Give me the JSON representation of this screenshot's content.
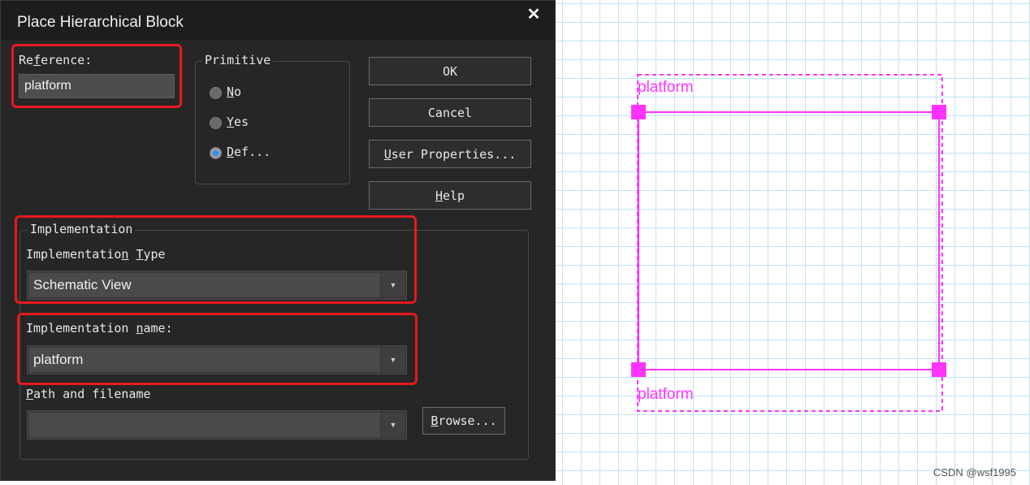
{
  "dialog": {
    "title": "Place Hierarchical Block",
    "close_glyph": "✕",
    "reference": {
      "label_pre": "Re",
      "label_u": "f",
      "label_post": "erence:",
      "value": "platform"
    },
    "primitive": {
      "legend": "Primitive",
      "options": [
        {
          "u": "N",
          "rest": "o",
          "selected": false
        },
        {
          "u": "Y",
          "rest": "es",
          "selected": false
        },
        {
          "u": "D",
          "rest": "ef...",
          "selected": true
        }
      ]
    },
    "buttons": {
      "ok": "OK",
      "cancel": "Cancel",
      "user_props_u": "U",
      "user_props_rest": "ser Properties...",
      "help_u": "H",
      "help_rest": "elp"
    },
    "implementation": {
      "legend": "Implementation",
      "type_label_pre": "Implementatio",
      "type_label_u1": "n",
      "type_label_mid": " ",
      "type_label_u2": "T",
      "type_label_post": "ype",
      "type_value": "Schematic View",
      "name_label_pre": "Implementation ",
      "name_label_u": "n",
      "name_label_post": "ame:",
      "name_value": "platform",
      "path_label_u": "P",
      "path_label_rest": "ath and filename",
      "path_value": "",
      "browse_u": "B",
      "browse_rest": "rowse..."
    }
  },
  "canvas": {
    "block_name_top": "platform",
    "block_name_bottom": "platform",
    "accent_color": "#ff33ff",
    "grid_color": "#bfe3f6",
    "watermark": "CSDN @wsf1995"
  }
}
